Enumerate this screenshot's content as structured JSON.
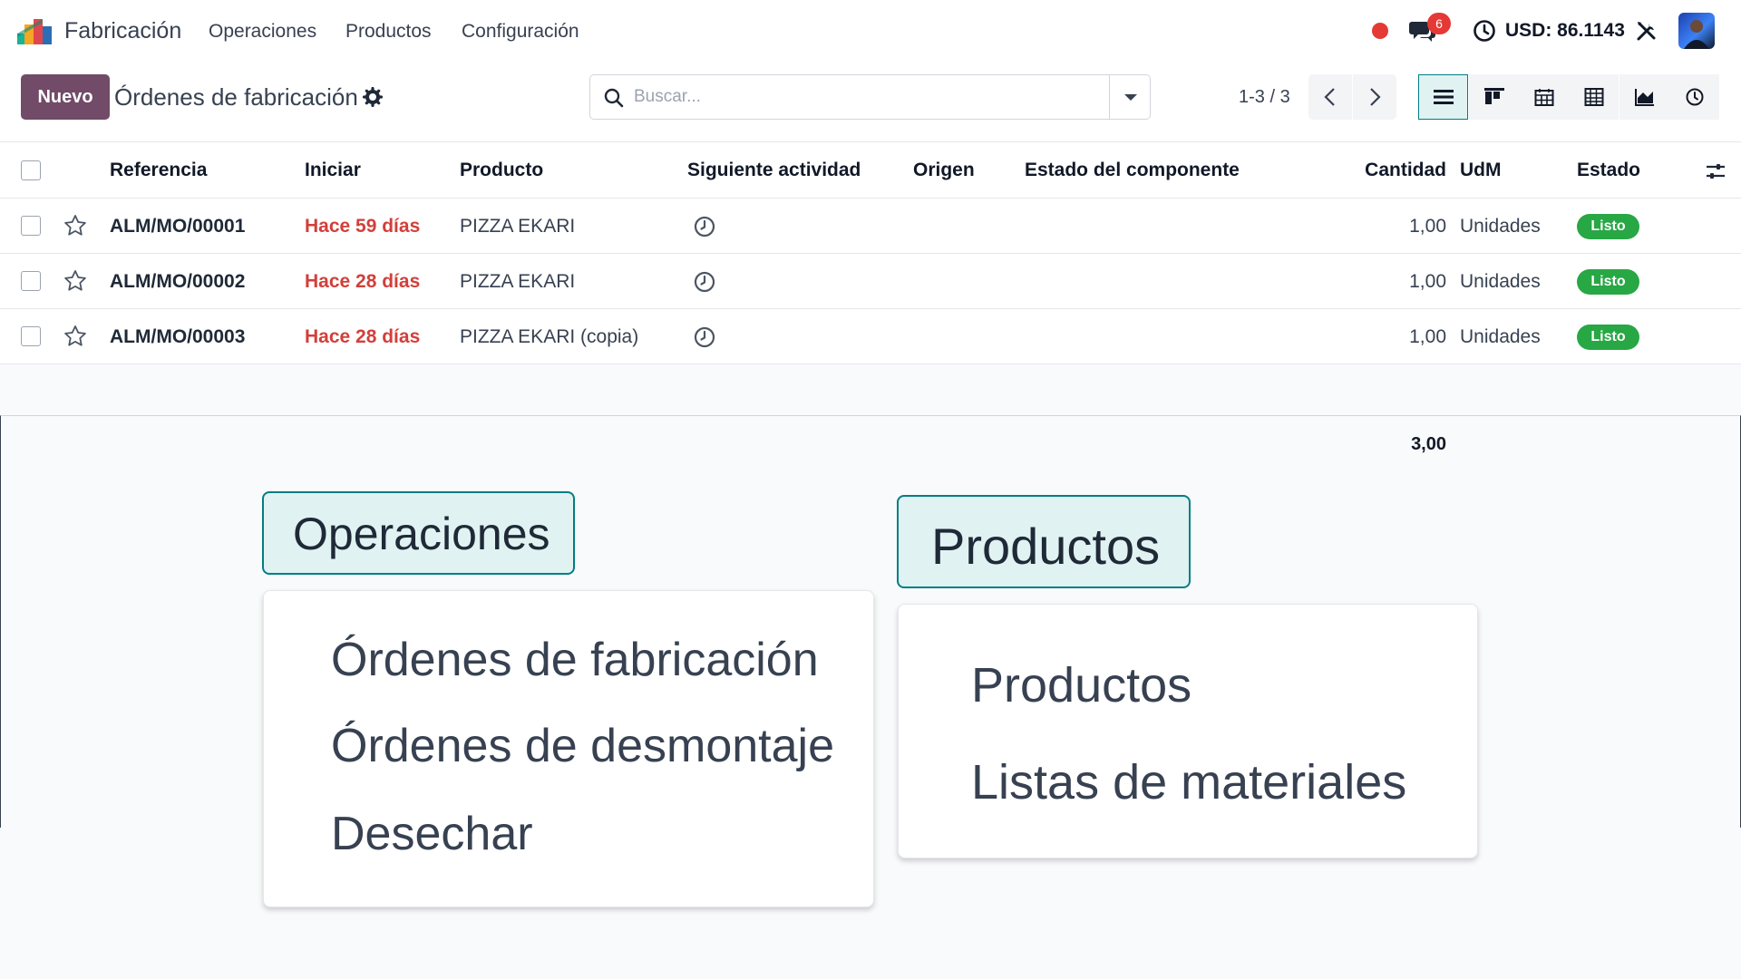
{
  "navbar": {
    "app_name": "Fabricación",
    "menu": [
      "Operaciones",
      "Productos",
      "Configuración"
    ],
    "chat_count": "6",
    "currency": "USD: 86.1143"
  },
  "control": {
    "new_label": "Nuevo",
    "breadcrumb": "Órdenes de fabricación",
    "search_placeholder": "Buscar...",
    "pager": "1-3 / 3"
  },
  "list": {
    "columns": {
      "reference": "Referencia",
      "start": "Iniciar",
      "product": "Producto",
      "next_activity": "Siguiente actividad",
      "origin": "Origen",
      "component_status": "Estado del componente",
      "quantity": "Cantidad",
      "uom": "UdM",
      "state": "Estado"
    },
    "rows": [
      {
        "reference": "ALM/MO/00001",
        "start": "Hace 59 días",
        "product": "PIZZA EKARI",
        "quantity": "1,00",
        "uom": "Unidades",
        "state": "Listo"
      },
      {
        "reference": "ALM/MO/00002",
        "start": "Hace 28 días",
        "product": "PIZZA EKARI",
        "quantity": "1,00",
        "uom": "Unidades",
        "state": "Listo"
      },
      {
        "reference": "ALM/MO/00003",
        "start": "Hace 28 días",
        "product": "PIZZA EKARI (copia)",
        "quantity": "1,00",
        "uom": "Unidades",
        "state": "Listo"
      }
    ],
    "total_quantity": "3,00"
  },
  "zoom_operations": {
    "tab": "Operaciones",
    "items": [
      "Órdenes de fabricación",
      "Órdenes de desmontaje",
      "Desechar"
    ]
  },
  "zoom_products": {
    "tab": "Productos",
    "items": [
      "Productos",
      "Listas de materiales"
    ]
  },
  "colors": {
    "brand": "#714b67",
    "accent": "#017e84",
    "overdue": "#d23f3a",
    "ready": "#28a745"
  }
}
